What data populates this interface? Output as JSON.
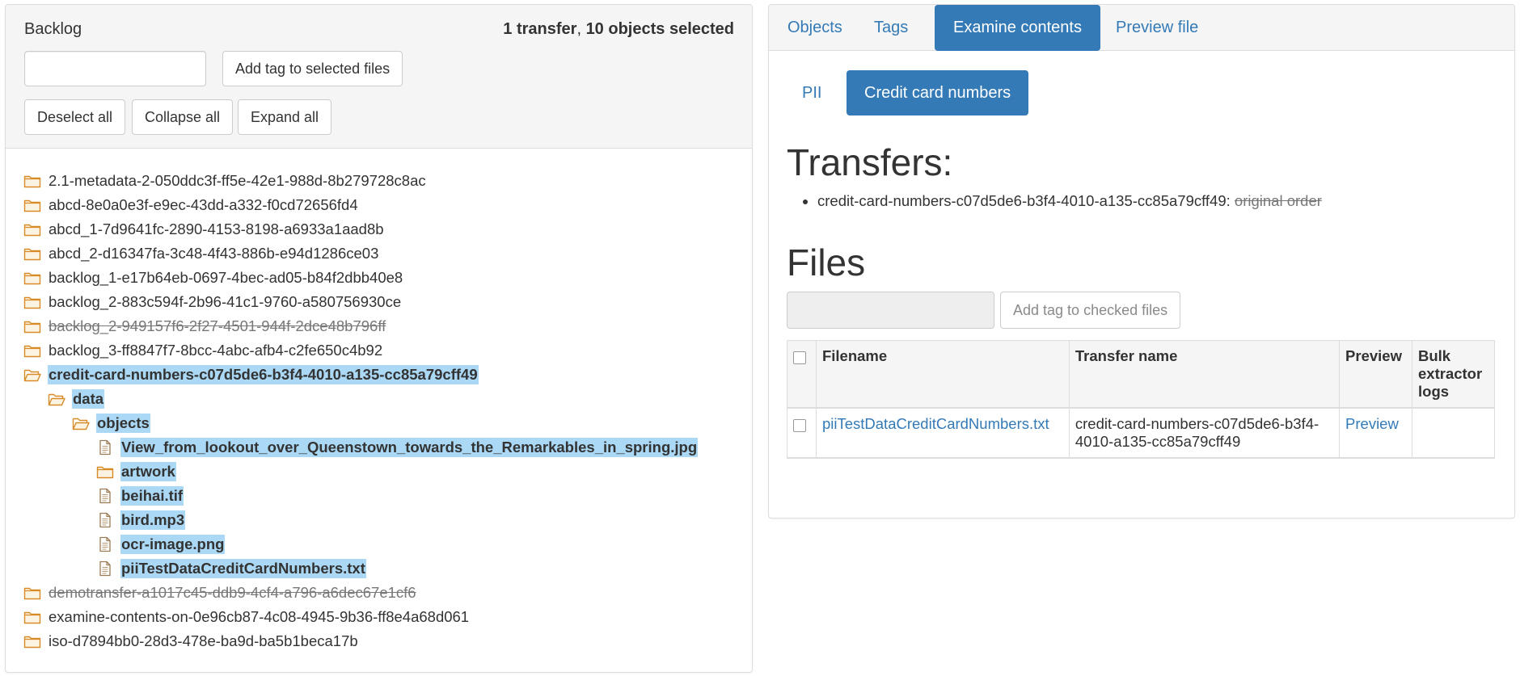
{
  "backlog": {
    "title": "Backlog",
    "summary": {
      "transfers_count": "1 transfer",
      "separator": ", ",
      "objects_count": "10 objects selected"
    },
    "tag_input": {
      "value": "",
      "placeholder": ""
    },
    "add_tag_label": "Add tag to selected files",
    "deselect_all_label": "Deselect all",
    "collapse_all_label": "Collapse all",
    "expand_all_label": "Expand all",
    "tree": [
      {
        "label": "2.1-metadata-2-050ddc3f-ff5e-42e1-988d-8b279728c8ac",
        "icon": "folder-closed-icon",
        "level": 0,
        "selected": false,
        "strike": false
      },
      {
        "label": "abcd-8e0a0e3f-e9ec-43dd-a332-f0cd72656fd4",
        "icon": "folder-closed-icon",
        "level": 0,
        "selected": false,
        "strike": false
      },
      {
        "label": "abcd_1-7d9641fc-2890-4153-8198-a6933a1aad8b",
        "icon": "folder-closed-icon",
        "level": 0,
        "selected": false,
        "strike": false
      },
      {
        "label": "abcd_2-d16347fa-3c48-4f43-886b-e94d1286ce03",
        "icon": "folder-closed-icon",
        "level": 0,
        "selected": false,
        "strike": false
      },
      {
        "label": "backlog_1-e17b64eb-0697-4bec-ad05-b84f2dbb40e8",
        "icon": "folder-closed-icon",
        "level": 0,
        "selected": false,
        "strike": false
      },
      {
        "label": "backlog_2-883c594f-2b96-41c1-9760-a580756930ce",
        "icon": "folder-closed-icon",
        "level": 0,
        "selected": false,
        "strike": false
      },
      {
        "label": "backlog_2-949157f6-2f27-4501-944f-2dce48b796ff",
        "icon": "folder-closed-icon",
        "level": 0,
        "selected": false,
        "strike": true
      },
      {
        "label": "backlog_3-ff8847f7-8bcc-4abc-afb4-c2fe650c4b92",
        "icon": "folder-closed-icon",
        "level": 0,
        "selected": false,
        "strike": false
      },
      {
        "label": "credit-card-numbers-c07d5de6-b3f4-4010-a135-cc85a79cff49",
        "icon": "folder-open-icon",
        "level": 0,
        "selected": true,
        "strike": false
      },
      {
        "label": "data",
        "icon": "folder-open-icon",
        "level": 1,
        "selected": true,
        "strike": false
      },
      {
        "label": "objects",
        "icon": "folder-open-icon",
        "level": 2,
        "selected": true,
        "strike": false
      },
      {
        "label": "View_from_lookout_over_Queenstown_towards_the_Remarkables_in_spring.jpg",
        "icon": "file-icon",
        "level": 3,
        "selected": true,
        "strike": false
      },
      {
        "label": "artwork",
        "icon": "folder-closed-icon",
        "level": 3,
        "selected": true,
        "strike": false
      },
      {
        "label": "beihai.tif",
        "icon": "file-icon",
        "level": 3,
        "selected": true,
        "strike": false
      },
      {
        "label": "bird.mp3",
        "icon": "file-icon",
        "level": 3,
        "selected": true,
        "strike": false
      },
      {
        "label": "ocr-image.png",
        "icon": "file-icon",
        "level": 3,
        "selected": true,
        "strike": false
      },
      {
        "label": "piiTestDataCreditCardNumbers.txt",
        "icon": "file-icon",
        "level": 3,
        "selected": true,
        "strike": false
      },
      {
        "label": "demotransfer-a1017c45-ddb9-4cf4-a796-a6dec67e1cf6",
        "icon": "folder-closed-icon",
        "level": 0,
        "selected": false,
        "strike": true
      },
      {
        "label": "examine-contents-on-0e96cb87-4c08-4945-9b36-ff8e4a68d061",
        "icon": "folder-closed-icon",
        "level": 0,
        "selected": false,
        "strike": false
      },
      {
        "label": "iso-d7894bb0-28d3-478e-ba9d-ba5b1beca17b",
        "icon": "folder-closed-icon",
        "level": 0,
        "selected": false,
        "strike": false
      }
    ]
  },
  "tabs": [
    {
      "label": "Objects",
      "active": false
    },
    {
      "label": "Tags",
      "active": false
    },
    {
      "label": "Examine contents",
      "active": true
    },
    {
      "label": "Preview file",
      "active": false
    }
  ],
  "sub_tabs": [
    {
      "label": "PII",
      "active": false
    },
    {
      "label": "Credit card numbers",
      "active": true
    }
  ],
  "transfers": {
    "heading": "Transfers:",
    "items": [
      {
        "name": "credit-card-numbers-c07d5de6-b3f4-4010-a135-cc85a79cff49:",
        "link": "original order"
      }
    ]
  },
  "files": {
    "heading": "Files",
    "tag_input": {
      "value": "",
      "placeholder": ""
    },
    "add_tag_label": "Add tag to checked files",
    "columns": [
      "Filename",
      "Transfer name",
      "Preview",
      "Bulk extractor logs"
    ],
    "rows": [
      {
        "filename": "piiTestDataCreditCardNumbers.txt",
        "transfer_name": "credit-card-numbers-c07d5de6-b3f4-4010-a135-cc85a79cff49",
        "preview": "Preview",
        "bulk_extractor_logs": ""
      }
    ]
  },
  "colors": {
    "accent": "#337ab7",
    "selection": "#aad8f5",
    "folder": "#e8a33d",
    "panel_header": "#f5f5f5"
  }
}
